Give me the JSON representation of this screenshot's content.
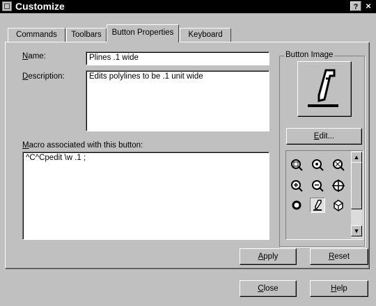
{
  "window": {
    "title": "Customize",
    "help_glyph": "?",
    "close_glyph": "×"
  },
  "tabs": [
    {
      "label": "Commands",
      "active": false
    },
    {
      "label": "Toolbars",
      "active": false
    },
    {
      "label": "Button Properties",
      "active": true
    },
    {
      "label": "Keyboard",
      "active": false
    }
  ],
  "form": {
    "name_label_mnemonic": "N",
    "name_label_rest": "ame:",
    "name_value": "Plines .1 wide",
    "description_label_mnemonic": "D",
    "description_label_rest": "escription:",
    "description_value": "Edits polylines to be .1 unit wide",
    "macro_label_mnemonic": "M",
    "macro_label_rest": "acro associated with this button:",
    "macro_value": "^C^Cpedit \\w .1 ;"
  },
  "button_image": {
    "group_title": "Button Image",
    "preview_icon": "pencil-underline-icon",
    "edit_label_mnemonic": "E",
    "edit_label_rest": "dit...",
    "icons": [
      {
        "name": "zoom-window-icon",
        "glyph": "Q"
      },
      {
        "name": "zoom-dynamic-icon",
        "glyph": "Q"
      },
      {
        "name": "zoom-scale-icon",
        "glyph": "Q"
      },
      {
        "name": "zoom-in-icon",
        "glyph": "+"
      },
      {
        "name": "zoom-out-icon",
        "glyph": "−"
      },
      {
        "name": "zoom-all-icon",
        "glyph": "+"
      },
      {
        "name": "circle-icon",
        "glyph": "●"
      },
      {
        "name": "pencil-icon",
        "glyph": "/"
      },
      {
        "name": "3d-box-icon",
        "glyph": "⬡"
      }
    ],
    "selected_icon_index": 7
  },
  "buttons": {
    "apply_mnemonic": "A",
    "apply_rest": "pply",
    "reset_mnemonic": "R",
    "reset_rest": "eset",
    "close_mnemonic": "C",
    "close_rest": "lose",
    "help_mnemonic": "H",
    "help_rest": "elp"
  },
  "colors": {
    "face": "#c0c0c0",
    "titlebar": "#000000",
    "field": "#ffffff"
  }
}
